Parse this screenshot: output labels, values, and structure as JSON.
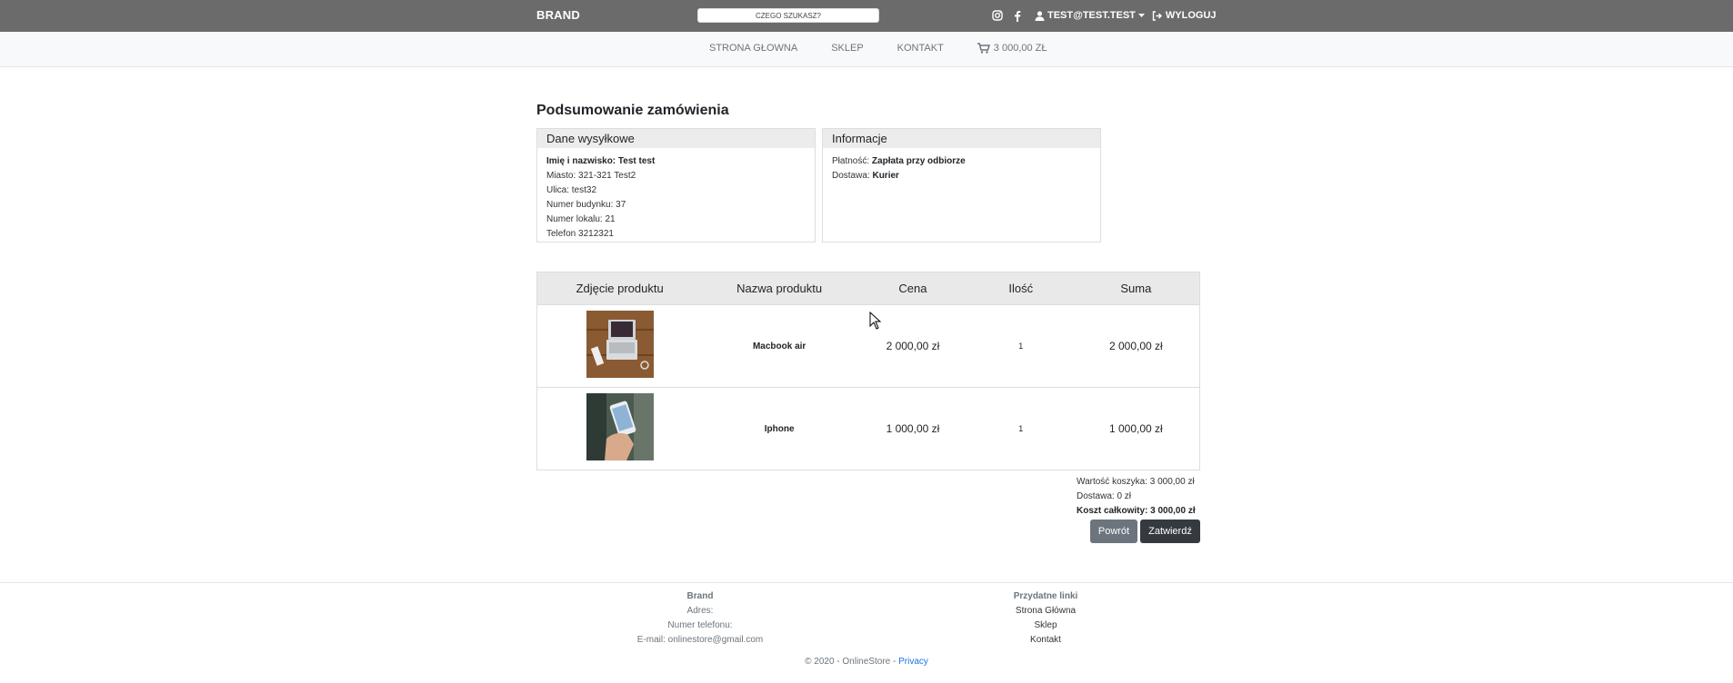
{
  "header": {
    "brand": "BRAND",
    "search_placeholder": "CZEGO SZUKASZ?",
    "user_label": "TEST@TEST.TEST",
    "logout_label": "WYLOGUJ"
  },
  "nav": {
    "items": [
      "STRONA GŁOWNA",
      "SKLEP",
      "KONTAKT"
    ],
    "cart_total": "3 000,00 ZŁ"
  },
  "page": {
    "title": "Podsumowanie zamówienia"
  },
  "shipping": {
    "title": "Dane wysyłkowe",
    "name_label": "Imię i nazwisko:",
    "name_value": "Test test",
    "city": "Miasto: 321-321 Test2",
    "street": "Ulica: test32",
    "building": "Numer budynku: 37",
    "apartment": "Numer lokalu: 21",
    "phone": "Telefon 3212321"
  },
  "info": {
    "title": "Informacje",
    "payment_label": "Płatność:",
    "payment_value": "Zapłata przy odbiorze",
    "delivery_label": "Dostawa:",
    "delivery_value": "Kurier"
  },
  "table": {
    "headers": [
      "Zdjęcie produktu",
      "Nazwa produktu",
      "Cena",
      "Ilość",
      "Suma"
    ],
    "rows": [
      {
        "name": "Macbook air",
        "price": "2 000,00 zł",
        "qty": "1",
        "sum": "2 000,00 zł"
      },
      {
        "name": "Iphone",
        "price": "1 000,00 zł",
        "qty": "1",
        "sum": "1 000,00 zł"
      }
    ]
  },
  "totals": {
    "cart_value": "Wartość koszyka: 3 000,00 zł",
    "delivery": "Dostawa: 0 zł",
    "total": "Koszt całkowity: 3 000,00 zł"
  },
  "buttons": {
    "back": "Powrót",
    "confirm": "Zatwierdź"
  },
  "footer": {
    "col1": {
      "title": "Brand",
      "address": "Adres:",
      "phone": "Numer telefonu:",
      "email": "E-mail: onlinestore@gmail.com"
    },
    "col2": {
      "title": "Przydatne linki",
      "links": [
        "Strona Główna",
        "Sklep",
        "Kontakt"
      ]
    },
    "copyright": "© 2020 - OnlineStore -",
    "privacy": "Privacy"
  },
  "colors": {
    "topbar": "#6b6b6b",
    "btn_back": "#6c757d",
    "btn_confirm": "#343a40",
    "link": "#1a73e8"
  }
}
